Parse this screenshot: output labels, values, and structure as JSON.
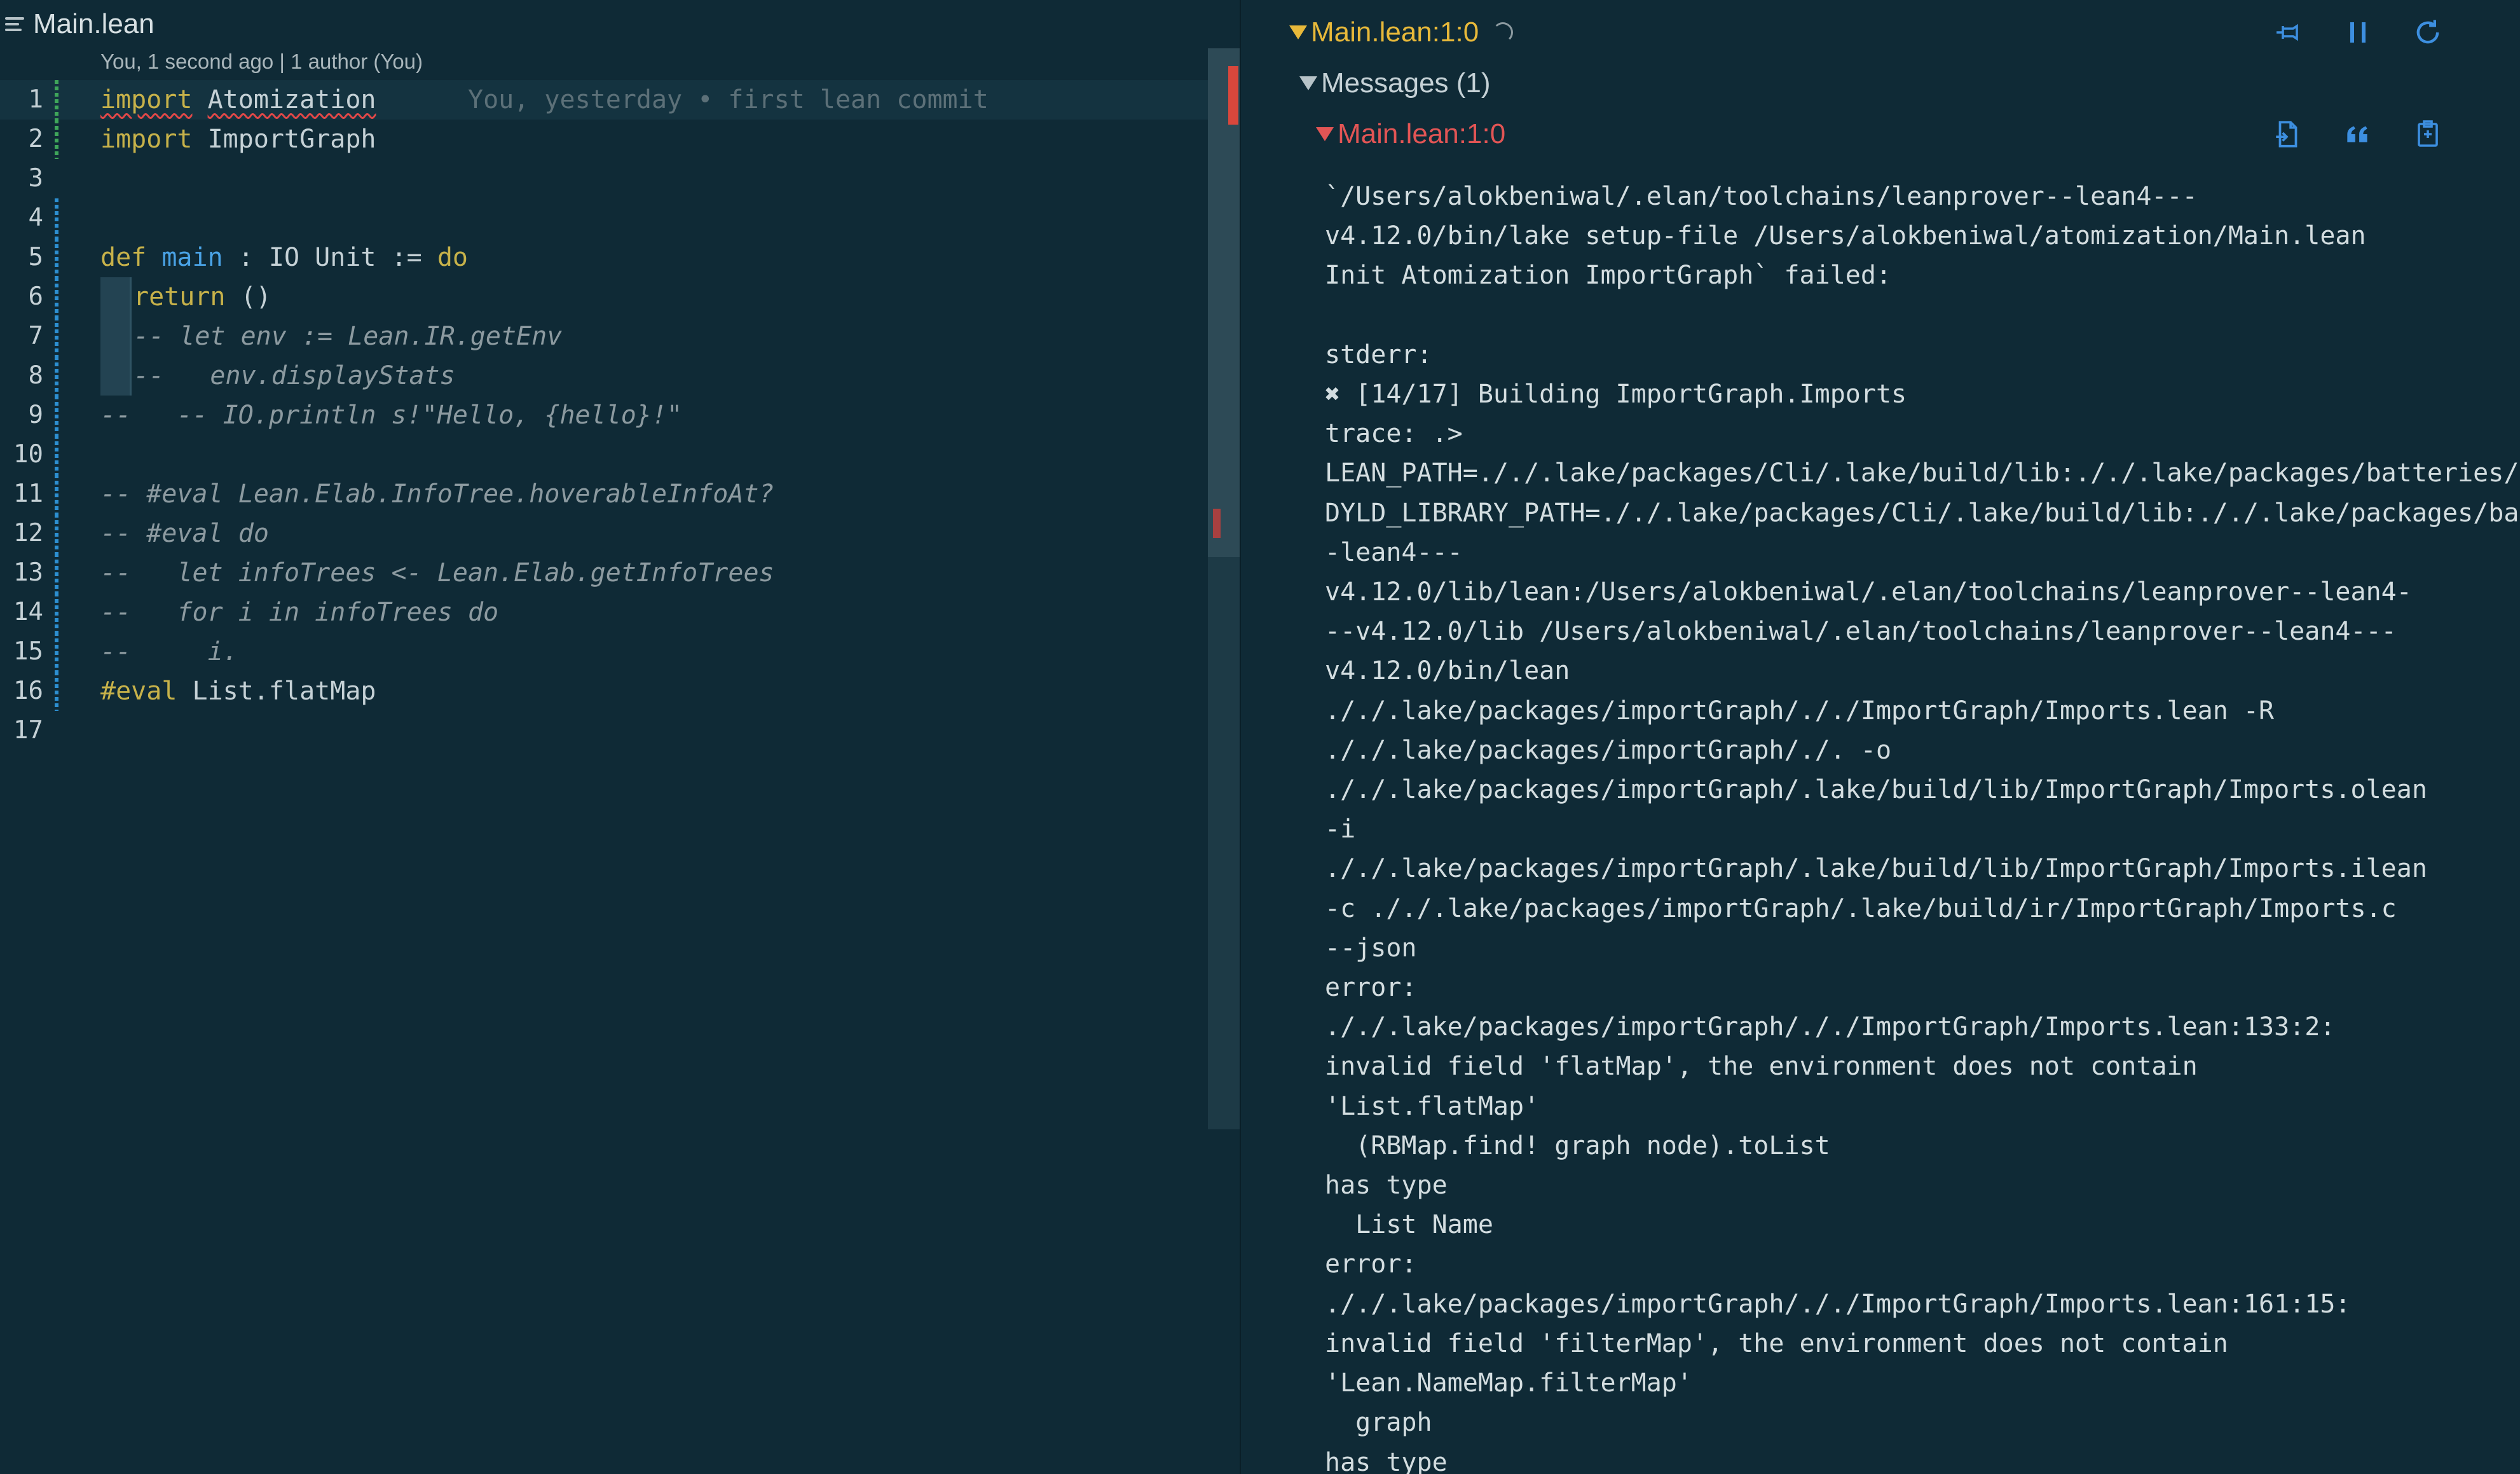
{
  "editor": {
    "tab_title": "Main.lean",
    "blame": "You, 1 second ago | 1 author (You)",
    "ghost_blame": "You, yesterday • first lean commit",
    "lines": [
      {
        "n": "1",
        "segments": [
          {
            "t": "import",
            "c": "kw err"
          },
          {
            "t": " "
          },
          {
            "t": "Atomization",
            "c": "err"
          }
        ]
      },
      {
        "n": "2",
        "segments": [
          {
            "t": "import",
            "c": "kw"
          },
          {
            "t": " ImportGraph"
          }
        ]
      },
      {
        "n": "3",
        "segments": []
      },
      {
        "n": "4",
        "segments": []
      },
      {
        "n": "5",
        "segments": [
          {
            "t": "def",
            "c": "kw"
          },
          {
            "t": " "
          },
          {
            "t": "main",
            "c": "fn"
          },
          {
            "t": " : IO Unit := "
          },
          {
            "t": "do",
            "c": "kw"
          }
        ]
      },
      {
        "n": "6",
        "segments": [
          {
            "t": "return",
            "c": "kw"
          },
          {
            "t": " ()"
          }
        ]
      },
      {
        "n": "7",
        "segments": [
          {
            "t": "-- let env := Lean.IR.getEnv",
            "c": "cm"
          }
        ]
      },
      {
        "n": "8",
        "segments": [
          {
            "t": "--   env.displayStats",
            "c": "cm"
          }
        ]
      },
      {
        "n": "9",
        "segments": [
          {
            "t": "--   -- IO.println s!\"Hello, {hello}!\"",
            "c": "cm"
          }
        ]
      },
      {
        "n": "10",
        "segments": []
      },
      {
        "n": "11",
        "segments": [
          {
            "t": "-- #eval Lean.Elab.InfoTree.hoverableInfoAt?",
            "c": "cm"
          }
        ]
      },
      {
        "n": "12",
        "segments": [
          {
            "t": "-- #eval do",
            "c": "cm"
          }
        ]
      },
      {
        "n": "13",
        "segments": [
          {
            "t": "--   let infoTrees <- Lean.Elab.getInfoTrees",
            "c": "cm"
          }
        ]
      },
      {
        "n": "14",
        "segments": [
          {
            "t": "--   for i in infoTrees do",
            "c": "cm"
          }
        ]
      },
      {
        "n": "15",
        "segments": [
          {
            "t": "--     i.",
            "c": "cm"
          }
        ]
      },
      {
        "n": "16",
        "segments": [
          {
            "t": "#eval",
            "c": "kw"
          },
          {
            "t": " List.flatMap"
          }
        ]
      },
      {
        "n": "17",
        "segments": []
      }
    ]
  },
  "infoview": {
    "header": "Main.lean:1:0",
    "messages_label": "Messages (1)",
    "message_location": "Main.lean:1:0",
    "header_icons": [
      "pin-icon",
      "pause-icon",
      "refresh-icon"
    ],
    "message_icons": [
      "go-to-file-icon",
      "copy-to-comment-icon",
      "copy-to-clipboard-icon"
    ],
    "message_lines": [
      "`/Users/alokbeniwal/.elan/toolchains/leanprover--lean4---",
      "v4.12.0/bin/lake setup-file /Users/alokbeniwal/atomization/Main.lean",
      "Init Atomization ImportGraph` failed:",
      "",
      "stderr:",
      "✖ [14/17] Building ImportGraph.Imports",
      "trace: .>",
      "LEAN_PATH=././.lake/packages/Cli/.lake/build/lib:././.lake/packages/batteries/.lake/build/lib",
      "DYLD_LIBRARY_PATH=././.lake/packages/Cli/.lake/build/lib:././.lake/packages/batteries",
      "-lean4---",
      "v4.12.0/lib/lean:/Users/alokbeniwal/.elan/toolchains/leanprover--lean4-",
      "--v4.12.0/lib /Users/alokbeniwal/.elan/toolchains/leanprover--lean4---",
      "v4.12.0/bin/lean",
      "././.lake/packages/importGraph/././ImportGraph/Imports.lean -R",
      "././.lake/packages/importGraph/./. -o",
      "././.lake/packages/importGraph/.lake/build/lib/ImportGraph/Imports.olean",
      "-i",
      "././.lake/packages/importGraph/.lake/build/lib/ImportGraph/Imports.ilean",
      "-c ././.lake/packages/importGraph/.lake/build/ir/ImportGraph/Imports.c",
      "--json",
      "error:",
      "././.lake/packages/importGraph/././ImportGraph/Imports.lean:133:2:",
      "invalid field 'flatMap', the environment does not contain",
      "'List.flatMap'",
      "  (RBMap.find! graph node).toList",
      "has type",
      "  List Name",
      "error:",
      "././.lake/packages/importGraph/././ImportGraph/Imports.lean:161:15:",
      "invalid field 'filterMap', the environment does not contain",
      "'Lean.NameMap.filterMap'",
      "  graph",
      "has type"
    ]
  }
}
